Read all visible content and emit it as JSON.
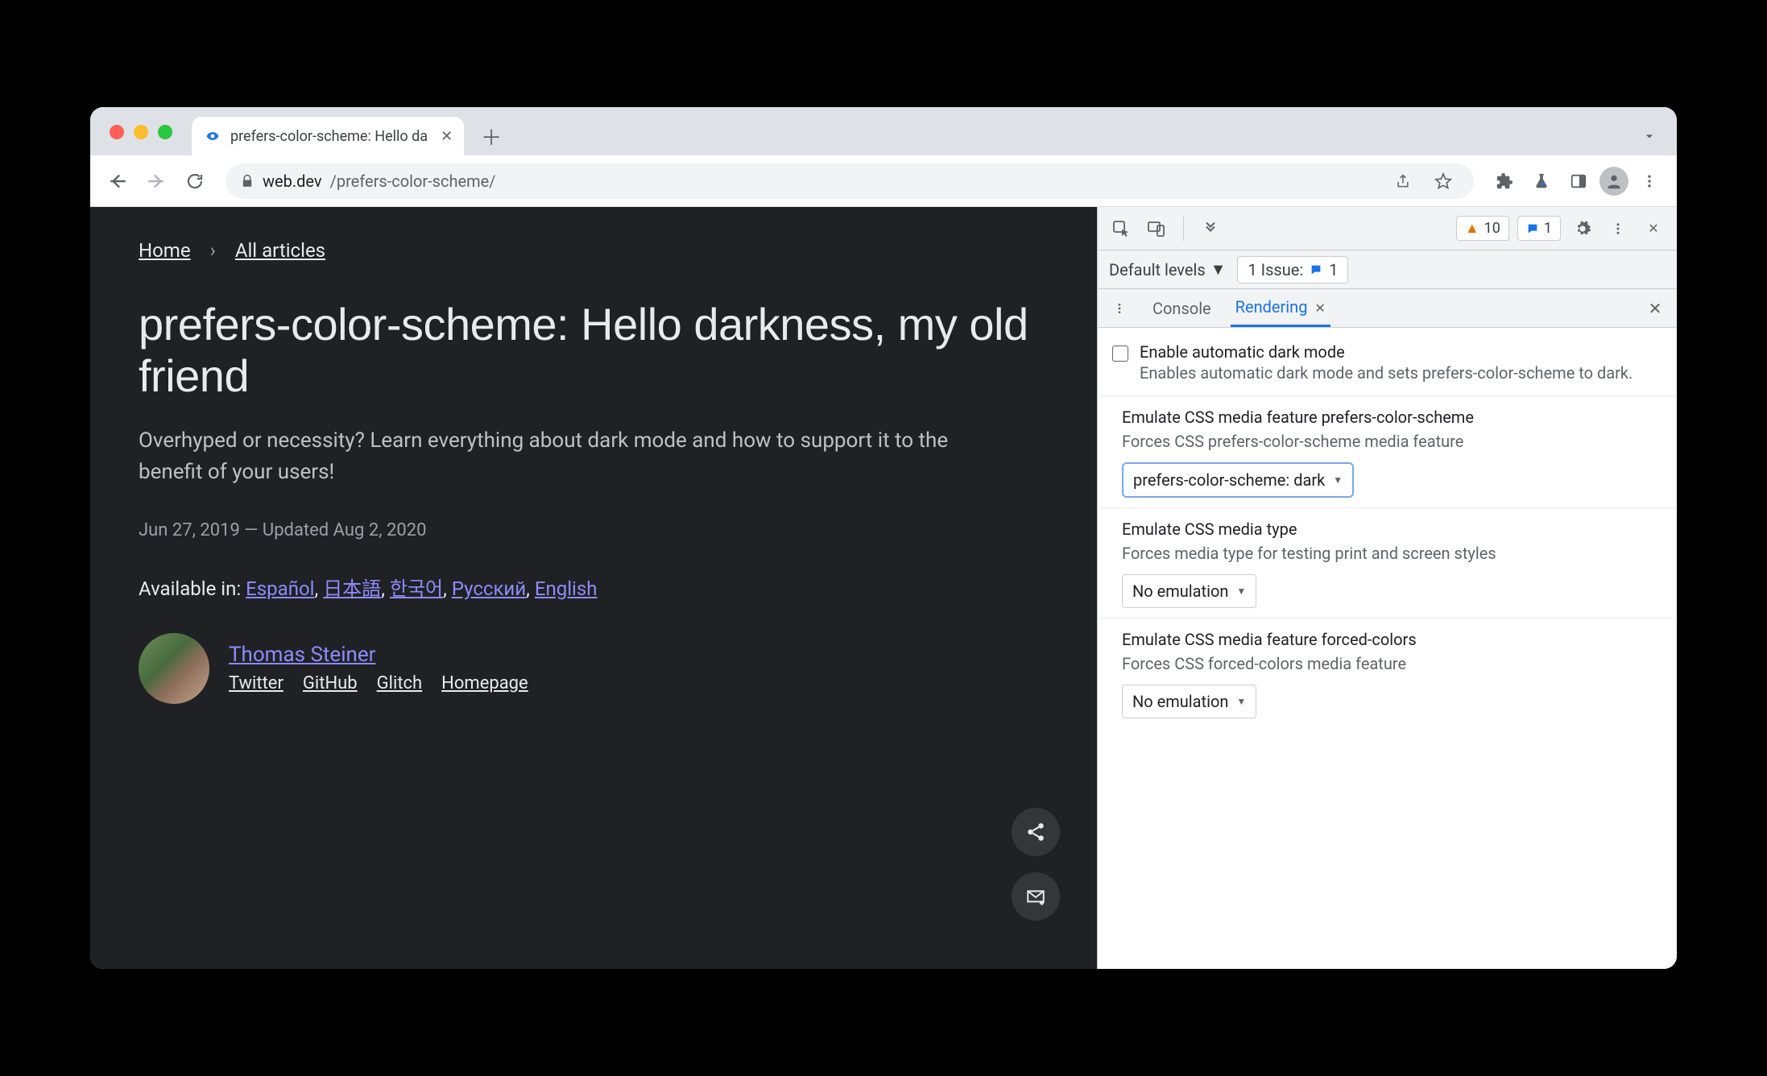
{
  "tab": {
    "title": "prefers-color-scheme: Hello da"
  },
  "url": {
    "host": "web.dev",
    "path": "/prefers-color-scheme/"
  },
  "breadcrumb": {
    "home": "Home",
    "all": "All articles"
  },
  "page": {
    "title": "prefers-color-scheme: Hello darkness, my old friend",
    "subtitle": "Overhyped or necessity? Learn everything about dark mode and how to support it to the benefit of your users!",
    "date": "Jun 27, 2019 — Updated Aug 2, 2020",
    "available_label": "Available in:",
    "languages": [
      "Español",
      "日本語",
      "한국어",
      "Русский",
      "English"
    ]
  },
  "author": {
    "name": "Thomas Steiner",
    "links": [
      "Twitter",
      "GitHub",
      "Glitch",
      "Homepage"
    ]
  },
  "devtools": {
    "warnings_count": "10",
    "messages_count": "1",
    "default_levels": "Default levels",
    "issues_label": "1 Issue:",
    "issues_count": "1",
    "drawer_tabs": {
      "console": "Console",
      "rendering": "Rendering"
    },
    "dark_mode": {
      "title": "Enable automatic dark mode",
      "desc": "Enables automatic dark mode and sets prefers-color-scheme to dark."
    },
    "prefers_color_scheme": {
      "label": "Emulate CSS media feature prefers-color-scheme",
      "desc": "Forces CSS prefers-color-scheme media feature",
      "value": "prefers-color-scheme: dark"
    },
    "media_type": {
      "label": "Emulate CSS media type",
      "desc": "Forces media type for testing print and screen styles",
      "value": "No emulation"
    },
    "forced_colors": {
      "label": "Emulate CSS media feature forced-colors",
      "desc": "Forces CSS forced-colors media feature",
      "value": "No emulation"
    }
  }
}
